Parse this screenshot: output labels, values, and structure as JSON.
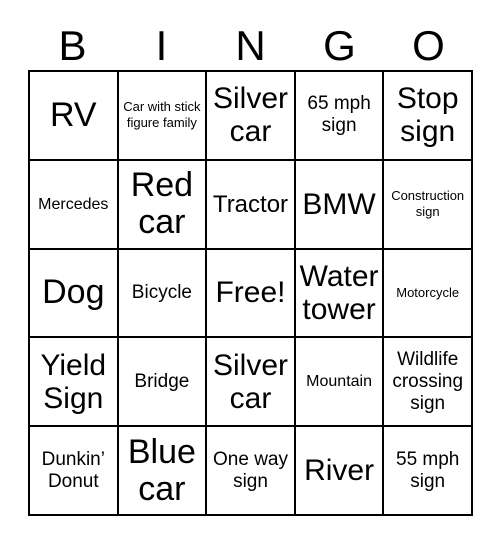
{
  "card": {
    "title_letters": [
      "B",
      "I",
      "N",
      "G",
      "O"
    ],
    "columns": 5,
    "rows": 5,
    "colors": {
      "background": "#ffffff",
      "text": "#000000",
      "grid_line": "#000000"
    },
    "cells": [
      [
        {
          "label": "RV",
          "size": "fs-xxl"
        },
        {
          "label": "Car with stick figure family",
          "size": "fs-xs"
        },
        {
          "label": "Silver car",
          "size": "fs-xl"
        },
        {
          "label": "65 mph sign",
          "size": "fs-m"
        },
        {
          "label": "Stop sign",
          "size": "fs-xl"
        }
      ],
      [
        {
          "label": "Mercedes",
          "size": "fs-s"
        },
        {
          "label": "Red car",
          "size": "fs-xxl"
        },
        {
          "label": "Tractor",
          "size": "fs-l"
        },
        {
          "label": "BMW",
          "size": "fs-xl"
        },
        {
          "label": "Construction sign",
          "size": "fs-xs"
        }
      ],
      [
        {
          "label": "Dog",
          "size": "fs-xxl"
        },
        {
          "label": "Bicycle",
          "size": "fs-m"
        },
        {
          "label": "Free!",
          "size": "fs-xl"
        },
        {
          "label": "Water tower",
          "size": "fs-xl"
        },
        {
          "label": "Motorcycle",
          "size": "fs-xs"
        }
      ],
      [
        {
          "label": "Yield Sign",
          "size": "fs-xl"
        },
        {
          "label": "Bridge",
          "size": "fs-m"
        },
        {
          "label": "Silver car",
          "size": "fs-xl"
        },
        {
          "label": "Mountain",
          "size": "fs-s"
        },
        {
          "label": "Wildlife crossing sign",
          "size": "fs-m"
        }
      ],
      [
        {
          "label": "Dunkin’ Donut",
          "size": "fs-m"
        },
        {
          "label": "Blue car",
          "size": "fs-xxl"
        },
        {
          "label": "One way sign",
          "size": "fs-m"
        },
        {
          "label": "River",
          "size": "fs-xl"
        },
        {
          "label": "55 mph sign",
          "size": "fs-m"
        }
      ]
    ]
  }
}
